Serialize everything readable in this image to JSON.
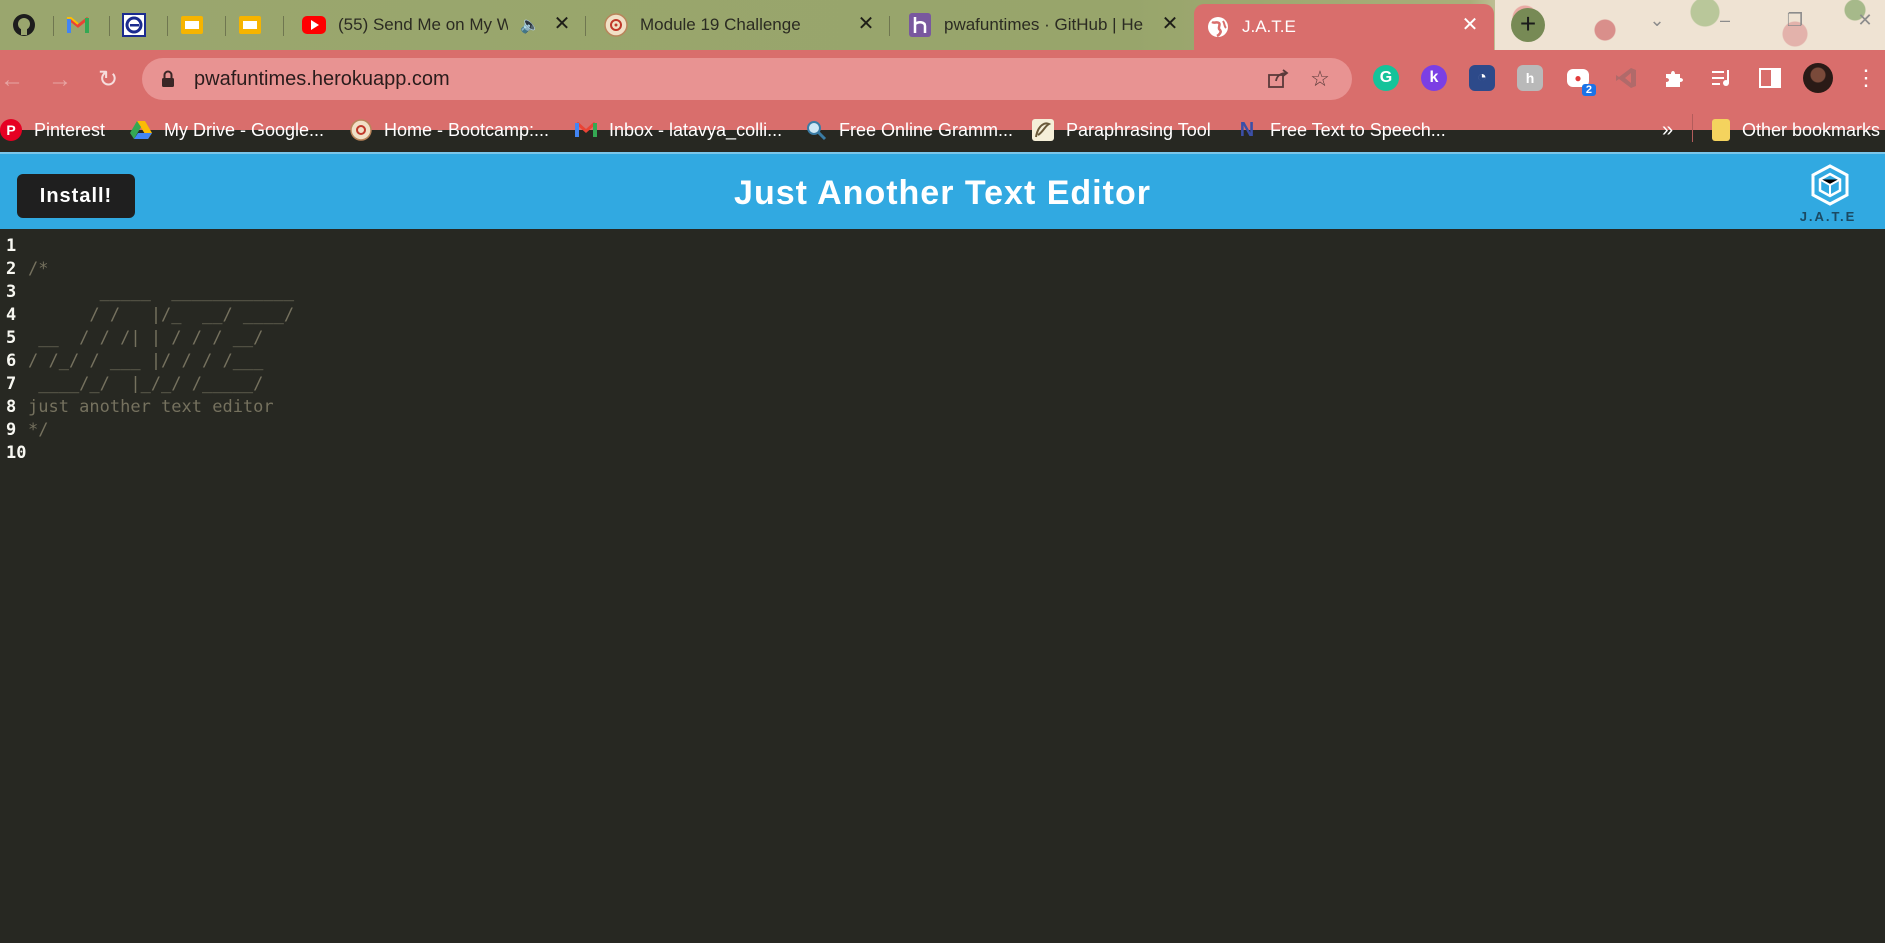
{
  "browser": {
    "tabs": [
      {
        "title": "",
        "icon": "github-icon"
      },
      {
        "title": "",
        "icon": "gmail-icon"
      },
      {
        "title": "",
        "icon": "edge-icon"
      },
      {
        "title": "",
        "icon": "slides-icon"
      },
      {
        "title": "",
        "icon": "slides-icon"
      },
      {
        "title": "(55) Send Me on My W",
        "icon": "youtube-icon"
      },
      {
        "title": "Module 19 Challenge",
        "icon": "bootcamp-icon"
      },
      {
        "title": "pwafuntimes · GitHub | He",
        "icon": "heroku-icon"
      },
      {
        "title": "J.A.T.E",
        "icon": "globe-icon"
      }
    ],
    "url": "pwafuntimes.herokuapp.com",
    "extension_badge": "2",
    "bookmarks": [
      {
        "label": "Pinterest"
      },
      {
        "label": "My Drive - Google..."
      },
      {
        "label": "Home - Bootcamp:..."
      },
      {
        "label": "Inbox - latavya_colli..."
      },
      {
        "label": "Free Online Gramm..."
      },
      {
        "label": "Paraphrasing Tool"
      },
      {
        "label": "Free Text to Speech..."
      }
    ],
    "more_bookmarks": "»",
    "other_bookmarks": "Other bookmarks"
  },
  "app": {
    "install_label": "Install!",
    "title": "Just Another Text Editor",
    "logo_text": "J.A.T.E"
  },
  "editor": {
    "lines": [
      {
        "num": "1",
        "text": ""
      },
      {
        "num": "2",
        "text": "/*"
      },
      {
        "num": "3",
        "text": "       _____  ____________"
      },
      {
        "num": "4",
        "text": "      / /   |/_  __/ ____/"
      },
      {
        "num": "5",
        "text": " __  / / /| | / / / __/"
      },
      {
        "num": "6",
        "text": "/ /_/ / ___ |/ / / /___"
      },
      {
        "num": "7",
        "text": " ____/_/  |_/_/ /_____/"
      },
      {
        "num": "8",
        "text": "just another text editor"
      },
      {
        "num": "9",
        "text": "*/"
      },
      {
        "num": "10",
        "text": ""
      }
    ]
  },
  "colors": {
    "header_blue": "#31a9e1",
    "editor_bg": "#272822",
    "comment": "#75715e",
    "chrome_active": "#d96e6c"
  }
}
